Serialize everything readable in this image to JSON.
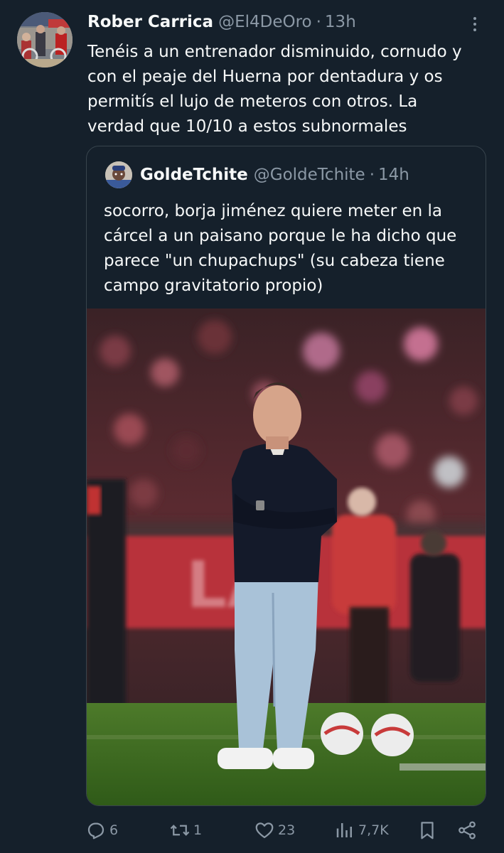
{
  "tweet": {
    "author_name": "Rober Carrica",
    "author_handle": "@El4DeOro",
    "separator": "·",
    "time": "13h",
    "text": "Tenéis a un entrenador disminuido, cornudo y\ncon el peaje del Huerna por dentadura y os\npermitís el lujo de meteros con otros. La\nverdad que 10/10 a estos subnormales"
  },
  "quoted": {
    "author_name": "GoldeTchite",
    "author_handle": "@GoldeTchite",
    "separator": "·",
    "time": "14h",
    "text": "socorro, borja jiménez quiere meter en la\ncárcel a un paisano porque le ha dicho que\nparece \"un chupachups\" (su cabeza tiene\ncampo gravitatorio propio)"
  },
  "actions": {
    "replies": "6",
    "reposts": "1",
    "likes": "23",
    "views": "7,7K"
  },
  "icons": {
    "more": "more-icon",
    "reply": "reply-icon",
    "repost": "repost-icon",
    "like": "like-icon",
    "views": "views-icon",
    "bookmark": "bookmark-icon",
    "share": "share-icon"
  },
  "colors": {
    "background": "#15202b",
    "text_primary": "#f7f9f9",
    "text_secondary": "#8b98a5",
    "border": "#38444d"
  }
}
